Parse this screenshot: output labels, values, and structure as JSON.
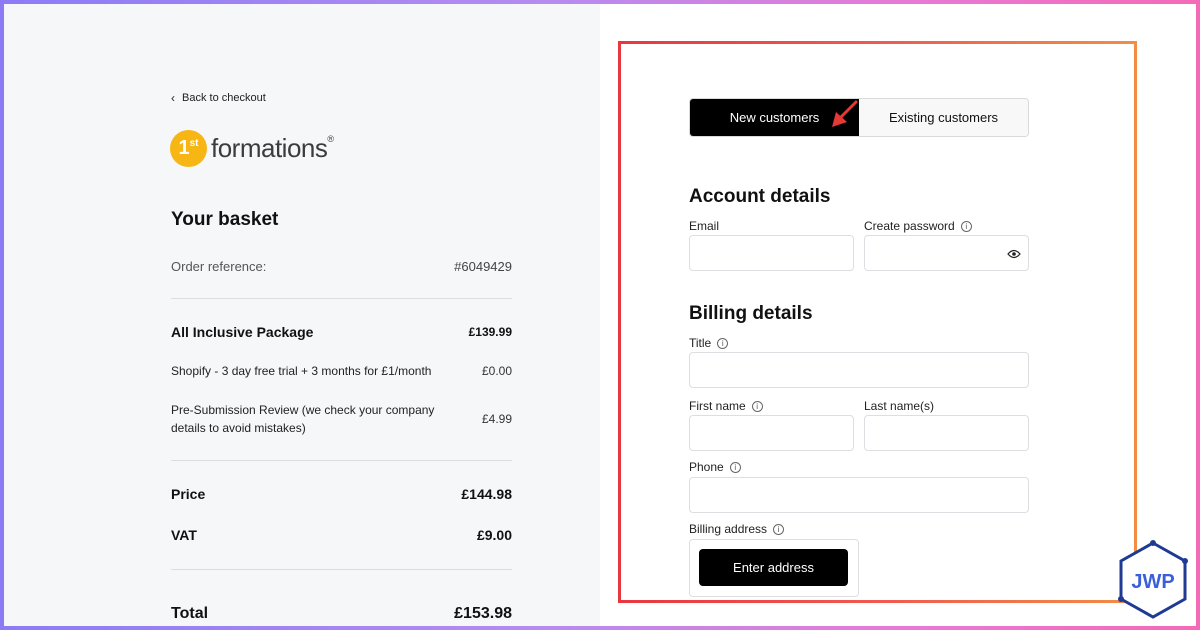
{
  "basket": {
    "back_link": "Back to checkout",
    "logo_number": "1",
    "logo_superscript": "st",
    "logo_text": "formations",
    "logo_reg": "®",
    "title": "Your basket",
    "order_reference_label": "Order reference:",
    "order_reference_value": "#6049429",
    "package": {
      "label": "All Inclusive Package",
      "price": "£139.99"
    },
    "items": [
      {
        "label": "Shopify - 3 day free trial + 3 months for £1/month",
        "price": "£0.00"
      },
      {
        "label": "Pre-Submission Review (we check your company details to avoid mistakes)",
        "price": "£4.99"
      }
    ],
    "price_label": "Price",
    "price_value": "£144.98",
    "vat_label": "VAT",
    "vat_value": "£9.00",
    "total_label": "Total",
    "total_value": "£153.98"
  },
  "form": {
    "tabs": [
      {
        "label": "New customers",
        "active": true
      },
      {
        "label": "Existing customers",
        "active": false
      }
    ],
    "account_title": "Account details",
    "email_label": "Email",
    "password_label": "Create password",
    "billing_title": "Billing details",
    "title_label": "Title",
    "first_name_label": "First name",
    "last_name_label": "Last name(s)",
    "phone_label": "Phone",
    "billing_address_label": "Billing address",
    "enter_address_button": "Enter address",
    "info_glyph": "i"
  },
  "watermark": {
    "text": "JWP"
  },
  "colors": {
    "accent_black": "#000000",
    "logo_yellow": "#f7b614",
    "highlight_red": "#e8383f",
    "highlight_orange": "#f38c45",
    "arrow_red": "#e53935"
  }
}
